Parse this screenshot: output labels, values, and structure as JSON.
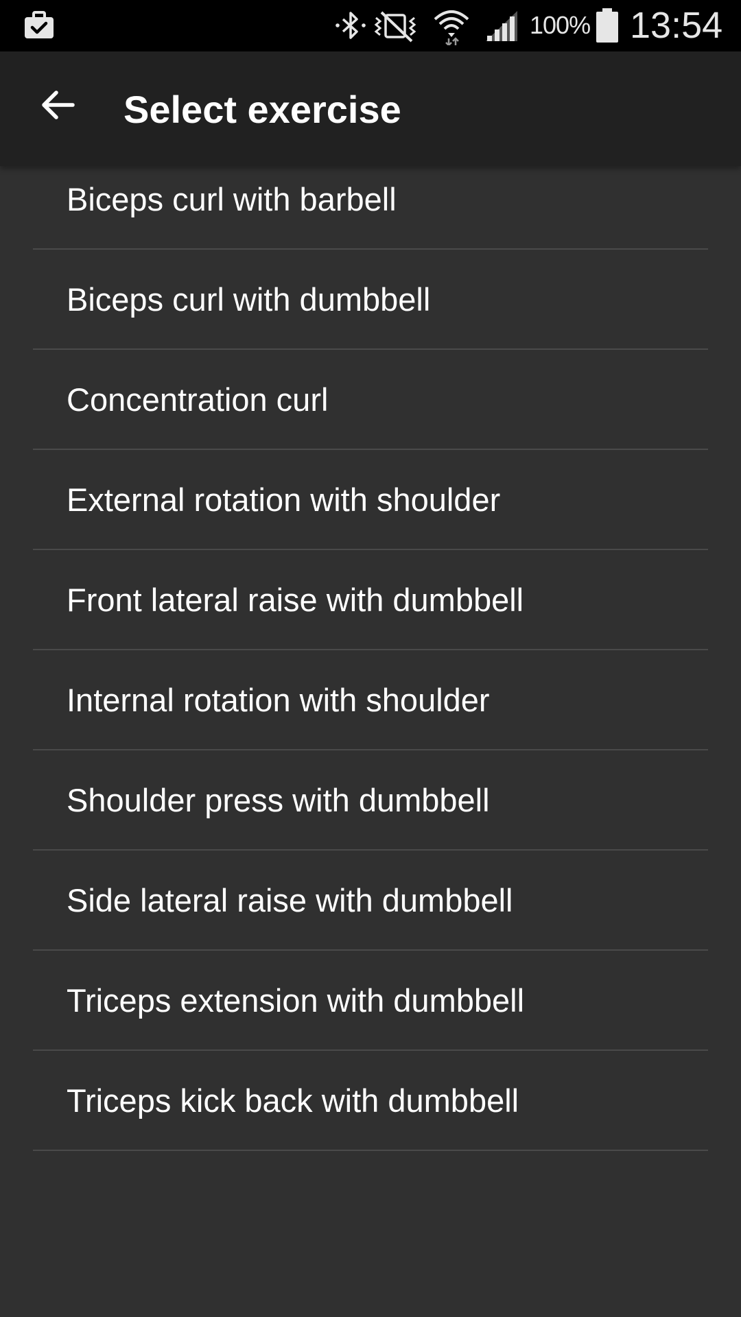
{
  "status_bar": {
    "left_icon": "briefcase-check-icon",
    "icons": [
      "bluetooth-icon",
      "vibrate-icon",
      "wifi-icon",
      "signal-icon",
      "battery-icon"
    ],
    "battery_percent": "100%",
    "time": "13:54",
    "background_color": "#000000"
  },
  "app_bar": {
    "back_icon": "arrow-left-icon",
    "title": "Select exercise",
    "background_color": "#212121"
  },
  "exercises": [
    "Biceps curl with barbell",
    "Biceps curl with dumbbell",
    "Concentration curl",
    "External rotation with shoulder",
    "Front lateral raise with dumbbell",
    "Internal rotation with shoulder",
    "Shoulder press with dumbbell",
    "Side lateral raise with dumbbell",
    "Triceps extension with dumbbell",
    "Triceps kick back with dumbbell"
  ],
  "colors": {
    "background": "#303030",
    "divider": "#4a4a4a",
    "text": "#ffffff"
  }
}
